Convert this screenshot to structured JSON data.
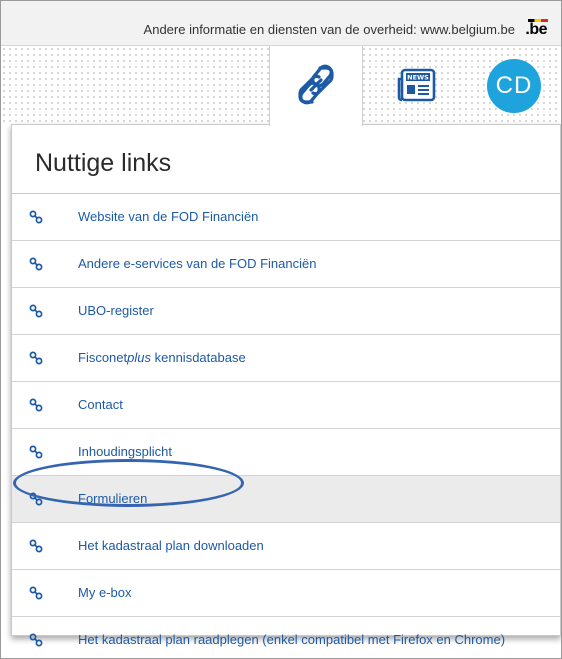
{
  "govbar": {
    "text": "Andere informatie en diensten van de overheid: www.belgium.be",
    "logo": ".be"
  },
  "toolbar": {
    "links_icon": "chain-link-icon",
    "news_icon": "newspaper-icon",
    "news_badge": "NEWS",
    "avatar_initials": "CD",
    "avatar_color": "#1fa3dc"
  },
  "panel": {
    "title": "Nuttige links",
    "link_color": "#1d5aa6",
    "items": [
      {
        "label": "Website van de FOD Financiën"
      },
      {
        "label": "Andere e-services van de FOD Financiën"
      },
      {
        "label": "UBO-register"
      },
      {
        "label_pre": "Fisconet",
        "label_em": "plus",
        "label_post": " kennisdatabase"
      },
      {
        "label": "Contact"
      },
      {
        "label": "Inhoudingsplicht"
      },
      {
        "label": "Formulieren",
        "active": true
      },
      {
        "label": "Het kadastraal plan downloaden"
      },
      {
        "label": "My e-box"
      },
      {
        "label": "Het kadastraal plan raadplegen (enkel compatibel met Firefox en Chrome)"
      }
    ]
  },
  "annotation": {
    "highlighted_item": "Formulieren",
    "ring_color": "#3565b0"
  }
}
